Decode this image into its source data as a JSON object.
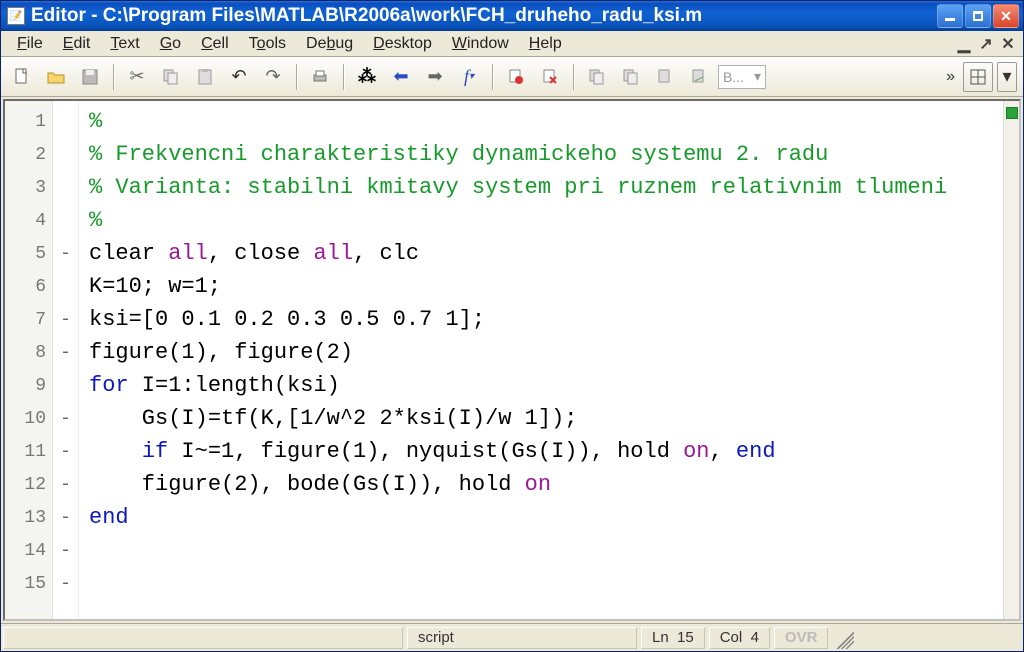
{
  "title": "Editor - C:\\Program Files\\MATLAB\\R2006a\\work\\FCH_druheho_radu_ksi.m",
  "menu": {
    "file": "File",
    "edit": "Edit",
    "text": "Text",
    "go": "Go",
    "cell": "Cell",
    "tools": "Tools",
    "debug": "Debug",
    "desktop": "Desktop",
    "window": "Window",
    "help": "Help"
  },
  "toolbar": {
    "base_label": "B...",
    "icons": {
      "new": "new-file-icon",
      "open": "open-folder-icon",
      "save": "save-icon",
      "cut": "cut-icon",
      "copy": "copy-icon",
      "paste": "paste-icon",
      "undo": "undo-icon",
      "redo": "redo-icon",
      "print": "print-icon",
      "find": "find-icon",
      "back": "back-icon",
      "forward": "forward-icon",
      "fx": "fx-icon",
      "setclear": "set-clear-bp-icon",
      "clearall": "clear-all-bp-icon",
      "stepin": "step-in-icon",
      "stepover": "step-over-icon",
      "stepout": "step-out-icon",
      "continue": "continue-icon",
      "stack": "stack-icon"
    }
  },
  "code": {
    "lines": [
      {
        "n": 1,
        "mark": "",
        "segs": [
          [
            "comment",
            "%"
          ]
        ]
      },
      {
        "n": 2,
        "mark": "",
        "segs": [
          [
            "comment",
            "% Frekvencni charakteristiky dynamickeho systemu 2. radu"
          ]
        ]
      },
      {
        "n": 3,
        "mark": "",
        "segs": [
          [
            "comment",
            "% Varianta: stabilni kmitavy system pri ruznem relativnim tlumeni"
          ]
        ]
      },
      {
        "n": 4,
        "mark": "",
        "segs": [
          [
            "comment",
            "%"
          ]
        ]
      },
      {
        "n": 5,
        "mark": "-",
        "segs": [
          [
            "plain",
            "clear "
          ],
          [
            "string",
            "all"
          ],
          [
            "plain",
            ", close "
          ],
          [
            "string",
            "all"
          ],
          [
            "plain",
            ", clc"
          ]
        ]
      },
      {
        "n": 6,
        "mark": "",
        "segs": [
          [
            "plain",
            ""
          ]
        ]
      },
      {
        "n": 7,
        "mark": "-",
        "segs": [
          [
            "plain",
            "K=10; w=1;"
          ]
        ]
      },
      {
        "n": 8,
        "mark": "-",
        "segs": [
          [
            "plain",
            "ksi=[0 0.1 0.2 0.3 0.5 0.7 1];"
          ]
        ]
      },
      {
        "n": 9,
        "mark": "",
        "segs": [
          [
            "plain",
            ""
          ]
        ]
      },
      {
        "n": 10,
        "mark": "-",
        "segs": [
          [
            "plain",
            "figure(1), figure(2)"
          ]
        ]
      },
      {
        "n": 11,
        "mark": "-",
        "segs": [
          [
            "keyword",
            "for"
          ],
          [
            "plain",
            " I=1:length(ksi)"
          ]
        ]
      },
      {
        "n": 12,
        "mark": "-",
        "segs": [
          [
            "plain",
            "    Gs(I)=tf(K,[1/w^2 2*ksi(I)/w 1]);"
          ]
        ]
      },
      {
        "n": 13,
        "mark": "-",
        "segs": [
          [
            "plain",
            "    "
          ],
          [
            "keyword",
            "if"
          ],
          [
            "plain",
            " I~=1, figure(1), nyquist(Gs(I)), hold "
          ],
          [
            "string",
            "on"
          ],
          [
            "plain",
            ", "
          ],
          [
            "keyword",
            "end"
          ]
        ]
      },
      {
        "n": 14,
        "mark": "-",
        "segs": [
          [
            "plain",
            "    figure(2), bode(Gs(I)), hold "
          ],
          [
            "string",
            "on"
          ]
        ]
      },
      {
        "n": 15,
        "mark": "-",
        "segs": [
          [
            "keyword",
            "end"
          ]
        ]
      }
    ]
  },
  "status": {
    "type": "script",
    "ln_label": "Ln",
    "ln": "15",
    "col_label": "Col",
    "col": "4",
    "ovr": "OVR"
  }
}
